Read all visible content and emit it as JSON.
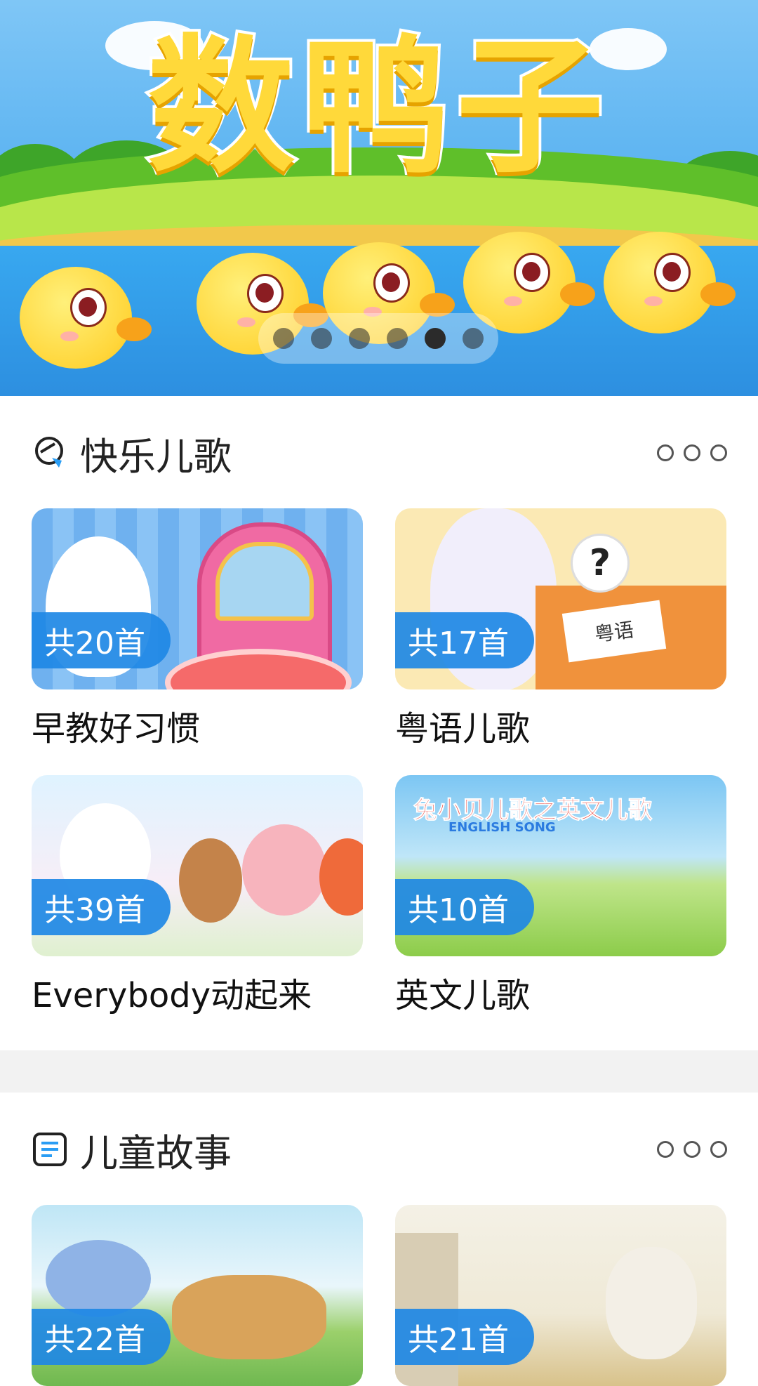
{
  "banner": {
    "title": "数鸭子",
    "slide_count": 6,
    "active_slide": 5
  },
  "sections": [
    {
      "title": "快乐儿歌",
      "icon": "music-note-icon",
      "cards": [
        {
          "badge": "共20首",
          "label": "早教好习惯"
        },
        {
          "badge": "共17首",
          "label": "粤语儿歌",
          "paper_text": "粤语"
        },
        {
          "badge": "共39首",
          "label": "Everybody动起来"
        },
        {
          "badge": "共10首",
          "label": "英文儿歌",
          "thumb_title": "兔小贝儿歌之英文儿歌",
          "thumb_subtitle": "ENGLISH SONG"
        }
      ]
    },
    {
      "title": "儿童故事",
      "icon": "document-icon",
      "cards": [
        {
          "badge": "共22首"
        },
        {
          "badge": "共21首"
        }
      ]
    }
  ],
  "colors": {
    "badge": "#1e88e5",
    "divider": "#f2f2f2",
    "text": "#222222"
  }
}
